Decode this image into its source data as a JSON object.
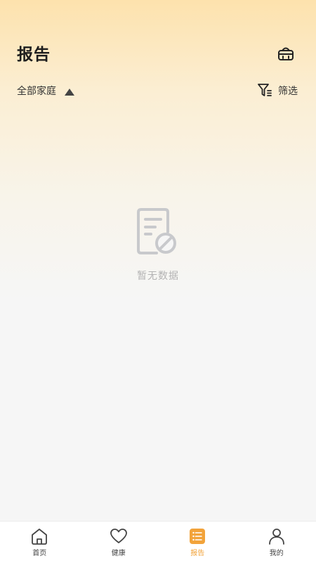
{
  "header": {
    "title": "报告",
    "basket_icon": "basket-icon",
    "family_select": {
      "label": "全部家庭",
      "icon": "triangle-up-icon"
    },
    "filter": {
      "label": "筛选",
      "icon": "filter-icon"
    }
  },
  "empty_state": {
    "icon": "empty-document-icon",
    "text": "暂无数据"
  },
  "tabbar": {
    "active_color": "#f2a33a",
    "items": [
      {
        "label": "首页",
        "icon": "home-icon",
        "active": false
      },
      {
        "label": "健康",
        "icon": "heart-icon",
        "active": false
      },
      {
        "label": "报告",
        "icon": "report-icon",
        "active": true
      },
      {
        "label": "我的",
        "icon": "user-icon",
        "active": false
      }
    ]
  }
}
